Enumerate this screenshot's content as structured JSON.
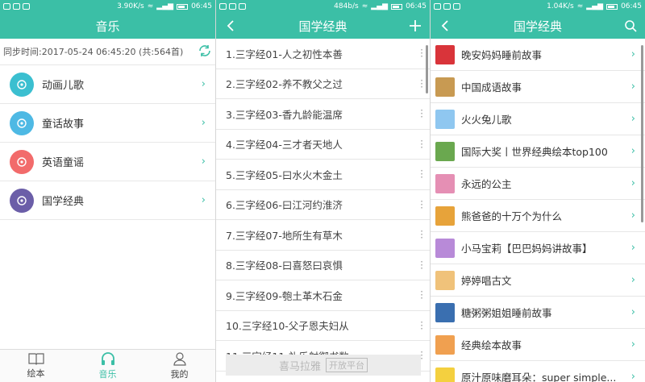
{
  "colors": {
    "accent": "#3bbfa6"
  },
  "status_bars": [
    {
      "speed": "3.90K/s",
      "time": "06:45"
    },
    {
      "speed": "484b/s",
      "time": "06:45"
    },
    {
      "speed": "1.04K/s",
      "time": "06:45"
    }
  ],
  "panel1": {
    "title": "音乐",
    "sync_text": "同步时间:2017-05-24 06:45:20 (共:564首)",
    "categories": [
      {
        "label": "动画儿歌",
        "icon": "cartoon-song-icon",
        "color": "#3bbfd0"
      },
      {
        "label": "童话故事",
        "icon": "fairy-tale-icon",
        "color": "#4eb9e4"
      },
      {
        "label": "英语童谣",
        "icon": "english-rhyme-icon",
        "color": "#f26b6b"
      },
      {
        "label": "国学经典",
        "icon": "classics-fan-icon",
        "color": "#6b5ea8"
      }
    ],
    "tabs": [
      {
        "label": "绘本",
        "icon": "book-icon"
      },
      {
        "label": "音乐",
        "icon": "headphones-icon"
      },
      {
        "label": "我的",
        "icon": "user-icon"
      }
    ]
  },
  "panel2": {
    "title": "国学经典",
    "items": [
      "1.三字经01-人之初性本善",
      "2.三字经02-养不教父之过",
      "3.三字经03-香九龄能温席",
      "4.三字经04-三才者天地人",
      "5.三字经05-曰水火木金土",
      "6.三字经06-曰江河约淮济",
      "7.三字经07-地所生有草木",
      "8.三字经08-曰喜怒曰哀惧",
      "9.三字经09-匏土革木石金",
      "10.三字经10-父子恩夫妇从",
      "11.三字经11-礼乐射御书数"
    ],
    "watermark": "喜马拉雅",
    "watermark_box": "开放平台"
  },
  "panel3": {
    "title": "国学经典",
    "items": [
      {
        "label": "晚安妈妈睡前故事",
        "thumb": "#d9343a"
      },
      {
        "label": "中国成语故事",
        "thumb": "#c89a52"
      },
      {
        "label": "火火兔儿歌",
        "thumb": "#8fc7f0"
      },
      {
        "label": "国际大奖丨世界经典绘本top100",
        "thumb": "#6aa84f"
      },
      {
        "label": "永远的公主",
        "thumb": "#e58fb4"
      },
      {
        "label": "熊爸爸的十万个为什么",
        "thumb": "#e7a33a"
      },
      {
        "label": "小马宝莉【巴巴妈妈讲故事】",
        "thumb": "#b88ad8"
      },
      {
        "label": "婷婷唱古文",
        "thumb": "#f0c27a"
      },
      {
        "label": "糖粥粥姐姐睡前故事",
        "thumb": "#3a6fb0"
      },
      {
        "label": "经典绘本故事",
        "thumb": "#f0a050"
      },
      {
        "label": "原汁原味磨耳朵：super simple...",
        "thumb": "#f4d03f"
      }
    ]
  }
}
